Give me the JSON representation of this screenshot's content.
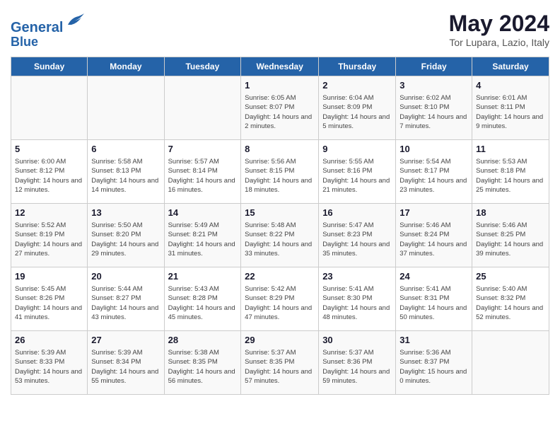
{
  "header": {
    "logo_line1": "General",
    "logo_line2": "Blue",
    "month": "May 2024",
    "location": "Tor Lupara, Lazio, Italy"
  },
  "days_of_week": [
    "Sunday",
    "Monday",
    "Tuesday",
    "Wednesday",
    "Thursday",
    "Friday",
    "Saturday"
  ],
  "weeks": [
    [
      {
        "day": "",
        "sunrise": "",
        "sunset": "",
        "daylight": ""
      },
      {
        "day": "",
        "sunrise": "",
        "sunset": "",
        "daylight": ""
      },
      {
        "day": "",
        "sunrise": "",
        "sunset": "",
        "daylight": ""
      },
      {
        "day": "1",
        "sunrise": "Sunrise: 6:05 AM",
        "sunset": "Sunset: 8:07 PM",
        "daylight": "Daylight: 14 hours and 2 minutes."
      },
      {
        "day": "2",
        "sunrise": "Sunrise: 6:04 AM",
        "sunset": "Sunset: 8:09 PM",
        "daylight": "Daylight: 14 hours and 5 minutes."
      },
      {
        "day": "3",
        "sunrise": "Sunrise: 6:02 AM",
        "sunset": "Sunset: 8:10 PM",
        "daylight": "Daylight: 14 hours and 7 minutes."
      },
      {
        "day": "4",
        "sunrise": "Sunrise: 6:01 AM",
        "sunset": "Sunset: 8:11 PM",
        "daylight": "Daylight: 14 hours and 9 minutes."
      }
    ],
    [
      {
        "day": "5",
        "sunrise": "Sunrise: 6:00 AM",
        "sunset": "Sunset: 8:12 PM",
        "daylight": "Daylight: 14 hours and 12 minutes."
      },
      {
        "day": "6",
        "sunrise": "Sunrise: 5:58 AM",
        "sunset": "Sunset: 8:13 PM",
        "daylight": "Daylight: 14 hours and 14 minutes."
      },
      {
        "day": "7",
        "sunrise": "Sunrise: 5:57 AM",
        "sunset": "Sunset: 8:14 PM",
        "daylight": "Daylight: 14 hours and 16 minutes."
      },
      {
        "day": "8",
        "sunrise": "Sunrise: 5:56 AM",
        "sunset": "Sunset: 8:15 PM",
        "daylight": "Daylight: 14 hours and 18 minutes."
      },
      {
        "day": "9",
        "sunrise": "Sunrise: 5:55 AM",
        "sunset": "Sunset: 8:16 PM",
        "daylight": "Daylight: 14 hours and 21 minutes."
      },
      {
        "day": "10",
        "sunrise": "Sunrise: 5:54 AM",
        "sunset": "Sunset: 8:17 PM",
        "daylight": "Daylight: 14 hours and 23 minutes."
      },
      {
        "day": "11",
        "sunrise": "Sunrise: 5:53 AM",
        "sunset": "Sunset: 8:18 PM",
        "daylight": "Daylight: 14 hours and 25 minutes."
      }
    ],
    [
      {
        "day": "12",
        "sunrise": "Sunrise: 5:52 AM",
        "sunset": "Sunset: 8:19 PM",
        "daylight": "Daylight: 14 hours and 27 minutes."
      },
      {
        "day": "13",
        "sunrise": "Sunrise: 5:50 AM",
        "sunset": "Sunset: 8:20 PM",
        "daylight": "Daylight: 14 hours and 29 minutes."
      },
      {
        "day": "14",
        "sunrise": "Sunrise: 5:49 AM",
        "sunset": "Sunset: 8:21 PM",
        "daylight": "Daylight: 14 hours and 31 minutes."
      },
      {
        "day": "15",
        "sunrise": "Sunrise: 5:48 AM",
        "sunset": "Sunset: 8:22 PM",
        "daylight": "Daylight: 14 hours and 33 minutes."
      },
      {
        "day": "16",
        "sunrise": "Sunrise: 5:47 AM",
        "sunset": "Sunset: 8:23 PM",
        "daylight": "Daylight: 14 hours and 35 minutes."
      },
      {
        "day": "17",
        "sunrise": "Sunrise: 5:46 AM",
        "sunset": "Sunset: 8:24 PM",
        "daylight": "Daylight: 14 hours and 37 minutes."
      },
      {
        "day": "18",
        "sunrise": "Sunrise: 5:46 AM",
        "sunset": "Sunset: 8:25 PM",
        "daylight": "Daylight: 14 hours and 39 minutes."
      }
    ],
    [
      {
        "day": "19",
        "sunrise": "Sunrise: 5:45 AM",
        "sunset": "Sunset: 8:26 PM",
        "daylight": "Daylight: 14 hours and 41 minutes."
      },
      {
        "day": "20",
        "sunrise": "Sunrise: 5:44 AM",
        "sunset": "Sunset: 8:27 PM",
        "daylight": "Daylight: 14 hours and 43 minutes."
      },
      {
        "day": "21",
        "sunrise": "Sunrise: 5:43 AM",
        "sunset": "Sunset: 8:28 PM",
        "daylight": "Daylight: 14 hours and 45 minutes."
      },
      {
        "day": "22",
        "sunrise": "Sunrise: 5:42 AM",
        "sunset": "Sunset: 8:29 PM",
        "daylight": "Daylight: 14 hours and 47 minutes."
      },
      {
        "day": "23",
        "sunrise": "Sunrise: 5:41 AM",
        "sunset": "Sunset: 8:30 PM",
        "daylight": "Daylight: 14 hours and 48 minutes."
      },
      {
        "day": "24",
        "sunrise": "Sunrise: 5:41 AM",
        "sunset": "Sunset: 8:31 PM",
        "daylight": "Daylight: 14 hours and 50 minutes."
      },
      {
        "day": "25",
        "sunrise": "Sunrise: 5:40 AM",
        "sunset": "Sunset: 8:32 PM",
        "daylight": "Daylight: 14 hours and 52 minutes."
      }
    ],
    [
      {
        "day": "26",
        "sunrise": "Sunrise: 5:39 AM",
        "sunset": "Sunset: 8:33 PM",
        "daylight": "Daylight: 14 hours and 53 minutes."
      },
      {
        "day": "27",
        "sunrise": "Sunrise: 5:39 AM",
        "sunset": "Sunset: 8:34 PM",
        "daylight": "Daylight: 14 hours and 55 minutes."
      },
      {
        "day": "28",
        "sunrise": "Sunrise: 5:38 AM",
        "sunset": "Sunset: 8:35 PM",
        "daylight": "Daylight: 14 hours and 56 minutes."
      },
      {
        "day": "29",
        "sunrise": "Sunrise: 5:37 AM",
        "sunset": "Sunset: 8:35 PM",
        "daylight": "Daylight: 14 hours and 57 minutes."
      },
      {
        "day": "30",
        "sunrise": "Sunrise: 5:37 AM",
        "sunset": "Sunset: 8:36 PM",
        "daylight": "Daylight: 14 hours and 59 minutes."
      },
      {
        "day": "31",
        "sunrise": "Sunrise: 5:36 AM",
        "sunset": "Sunset: 8:37 PM",
        "daylight": "Daylight: 15 hours and 0 minutes."
      },
      {
        "day": "",
        "sunrise": "",
        "sunset": "",
        "daylight": ""
      }
    ]
  ]
}
